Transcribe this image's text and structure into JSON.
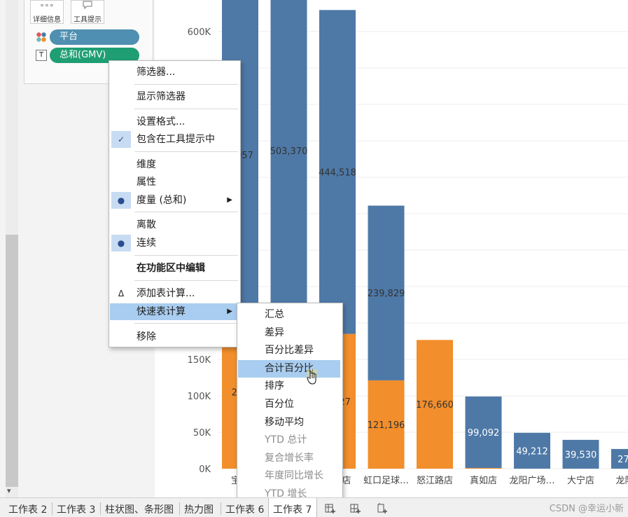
{
  "marks_card": {
    "detail_label": "详细信息",
    "tooltip_label": "工具提示",
    "pill_platform": "平台",
    "pill_gmv": "总和(GMV)",
    "colors": {
      "platform_pill": "#4f8fb1",
      "gmv_pill": "#1f9e74"
    }
  },
  "chart_data": {
    "type": "bar",
    "stacked": true,
    "y_ticks": [
      "0K",
      "50K",
      "100K",
      "150K",
      "600K"
    ],
    "ylim": [
      0,
      630000
    ],
    "categories": [
      "宝…",
      "",
      "…路店",
      "虹口足球…",
      "怒江路店",
      "真如店",
      "龙阳广场…",
      "大宁店",
      "龙阳…"
    ],
    "series": [
      {
        "color": "#f28e2b",
        "values": [
          211000,
          185000,
          185000,
          121196,
          176660,
          1000,
          0,
          0,
          0
        ]
      },
      {
        "color": "#4e79a7",
        "values": [
          440000,
          503370,
          444518,
          239829,
          0,
          98092,
          49212,
          39530,
          27000
        ]
      }
    ],
    "labels_top": [
      "…057",
      "503,370",
      "444,518",
      "239,829",
      "",
      "99,092",
      "49,212",
      "39,530",
      "27,…"
    ],
    "labels_bottom": [
      "211",
      "",
      "…227",
      "121,196",
      "176,660",
      "",
      "",
      "",
      ""
    ]
  },
  "context_menu": {
    "items": [
      {
        "label": "筛选器...",
        "bold": false
      },
      {
        "label": "显示筛选器",
        "bold": false
      },
      {
        "label": "设置格式...",
        "bold": false
      },
      {
        "label": "包含在工具提示中",
        "bold": false,
        "mark": "✓"
      },
      {
        "label": "维度",
        "bold": false
      },
      {
        "label": "属性",
        "bold": false
      },
      {
        "label": "度量 (总和)",
        "bold": false,
        "mark": "●",
        "submenu": true
      },
      {
        "label": "离散",
        "bold": false
      },
      {
        "label": "连续",
        "bold": false,
        "mark": "●"
      },
      {
        "label": "在功能区中编辑",
        "bold": true
      },
      {
        "label": "添加表计算...",
        "bold": false,
        "mark": "Δ"
      },
      {
        "label": "快速表计算",
        "bold": false,
        "submenu": true,
        "highlighted": true
      },
      {
        "label": "移除",
        "bold": false
      }
    ]
  },
  "quick_calc_menu": {
    "items": [
      {
        "label": "汇总",
        "enabled": true
      },
      {
        "label": "差异",
        "enabled": true
      },
      {
        "label": "百分比差异",
        "enabled": true
      },
      {
        "label": "合计百分比",
        "enabled": true,
        "highlighted": true
      },
      {
        "label": "排序",
        "enabled": true
      },
      {
        "label": "百分位",
        "enabled": true
      },
      {
        "label": "移动平均",
        "enabled": true
      },
      {
        "label": "YTD 总计",
        "enabled": false
      },
      {
        "label": "复合增长率",
        "enabled": false
      },
      {
        "label": "年度同比增长",
        "enabled": false
      },
      {
        "label": "YTD 增长",
        "enabled": false
      }
    ]
  },
  "tabs": [
    "工作表 2",
    "工作表 3",
    "柱状图、条形图",
    "热力图",
    "工作表 6",
    "工作表 7"
  ],
  "active_tab": "工作表 7",
  "watermark": "CSDN @幸运小新"
}
